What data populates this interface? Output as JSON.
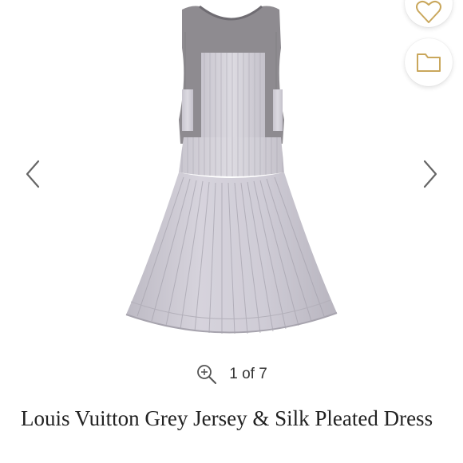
{
  "gallery": {
    "image_alt": "Louis Vuitton Grey Jersey & Silk Pleated Dress",
    "prev_icon": "chevron-left-icon",
    "next_icon": "chevron-right-icon",
    "counter": "1 of 7",
    "zoom_icon": "zoom-in-icon"
  },
  "actions": {
    "like_icon": "heart-icon",
    "save_icon": "folder-icon",
    "accent_color": "#c9a75c"
  },
  "product": {
    "title": "Louis Vuitton Grey Jersey & Silk Pleated Dress"
  }
}
